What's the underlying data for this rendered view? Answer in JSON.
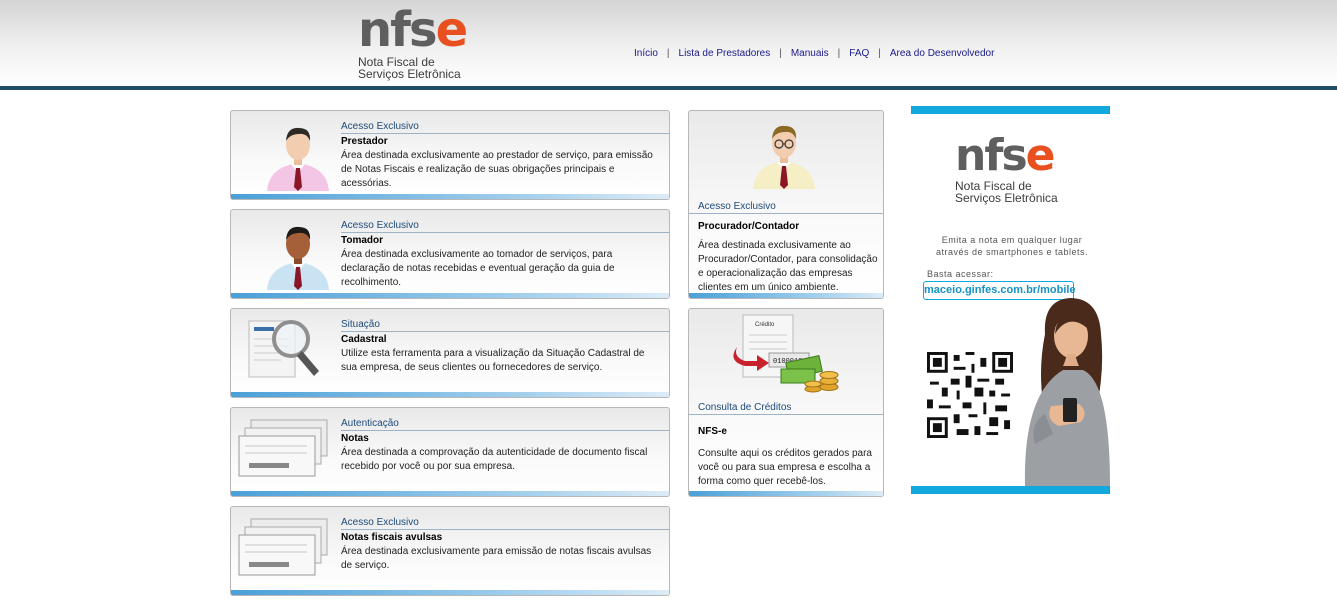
{
  "header": {
    "logo_word_main": "nfs",
    "logo_word_accent": "e",
    "logo_sub_1": "Nota Fiscal de",
    "logo_sub_2": "Serviços Eletrônica",
    "nav": [
      "Início",
      "Lista de Prestadores",
      "Manuais",
      "FAQ",
      "Area do Desenvolvedor"
    ]
  },
  "cards": {
    "prestador": {
      "heading": "Acesso Exclusivo",
      "title": "Prestador",
      "desc": "Área destinada exclusivamente ao prestador de serviço, para emissão de Notas Fiscais e realização de suas obrigações principais e acessórias."
    },
    "tomador": {
      "heading": "Acesso Exclusivo",
      "title": "Tomador",
      "desc": "Área destinada exclusivamente ao tomador de serviços, para declaração de notas recebidas e eventual geração da guia de recolhimento."
    },
    "situacao": {
      "heading": "Situação",
      "title": "Cadastral",
      "desc": "Utilize esta ferramenta para a visualização da Situação Cadastral de sua empresa, de seus clientes ou fornecedores de serviço."
    },
    "autenticacao": {
      "heading": "Autenticação",
      "title": "Notas",
      "desc": "Área destinada a comprovação da autenticidade de documento fiscal recebido por você ou por sua empresa."
    },
    "avulsas": {
      "heading": "Acesso Exclusivo",
      "title": "Notas fiscais avulsas",
      "desc": "Área destinada exclusivamente para emissão de notas fiscais avulsas de serviço."
    },
    "procurador": {
      "heading": "Acesso Exclusivo",
      "title": "Procurador/Contador",
      "desc": "Área destinada exclusivamente ao Procurador/Contador, para consolidação e operacionalização das empresas clientes em um único ambiente."
    },
    "creditos": {
      "heading": "Consulta de Créditos",
      "title": "NFS-e",
      "desc": "Consulte aqui os créditos gerados para você ou para sua empresa e escolha a forma como quer recebê-los.",
      "img_doc_label": "Crédito",
      "img_code": "0100010"
    }
  },
  "banner": {
    "logo_word_main": "nfs",
    "logo_word_accent": "e",
    "logo_sub_1": "Nota Fiscal de",
    "logo_sub_2": "Serviços Eletrônica",
    "text": "Emita a nota em qualquer lugar através de smartphones e tablets.",
    "label": "Basta acessar:",
    "url": "maceio.ginfes.com.br/mobile"
  },
  "colors": {
    "accent_orange": "#e8501f",
    "link_blue": "#1a1a8c",
    "heading_blue": "#1c4a78",
    "banner_cyan": "#12a8dc",
    "header_rule": "#1f4f63"
  }
}
